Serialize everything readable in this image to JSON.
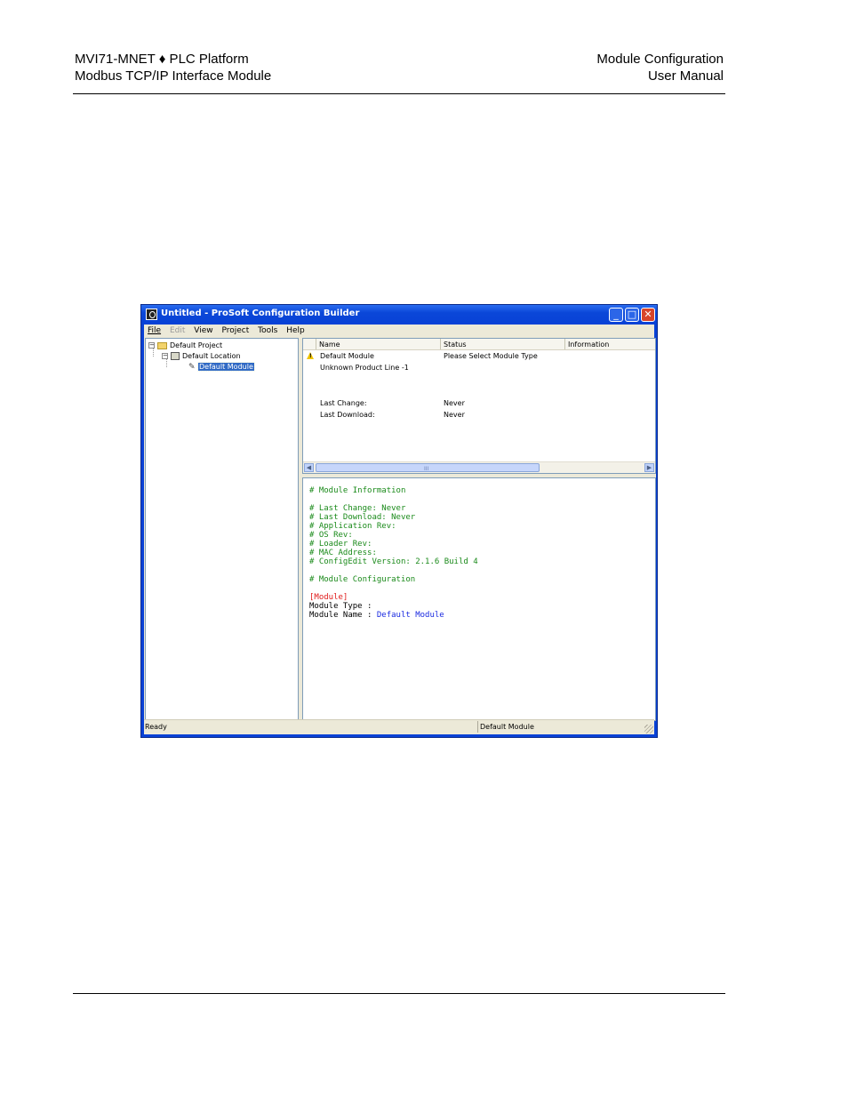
{
  "header": {
    "left_line1": "MVI71-MNET ♦ PLC Platform",
    "left_line2": "Modbus TCP/IP Interface Module",
    "right_line1": "Module Configuration",
    "right_line2": "User Manual"
  },
  "window": {
    "title": "Untitled - ProSoft Configuration Builder",
    "menu": {
      "file": "File",
      "edit": "Edit",
      "view": "View",
      "project": "Project",
      "tools": "Tools",
      "help": "Help"
    }
  },
  "tree": {
    "project": "Default Project",
    "location": "Default Location",
    "module": "Default Module",
    "expander_symbol": "−"
  },
  "list": {
    "columns": {
      "name": "Name",
      "status": "Status",
      "information": "Information"
    },
    "row_name": "Default Module",
    "row_status": "Please Select Module Type",
    "product_line": "Unknown Product Line -1",
    "last_change_label": "Last Change:",
    "last_change_value": "Never",
    "last_download_label": "Last Download:",
    "last_download_value": "Never",
    "scroll_grip": "III"
  },
  "config_text": {
    "l1": "# Module Information",
    "l2": "# Last Change: Never",
    "l3": "# Last Download: Never",
    "l4": "# Application Rev:",
    "l5": "# OS Rev:",
    "l6": "# Loader Rev:",
    "l7": "# MAC Address:",
    "l8": "# ConfigEdit Version: 2.1.6 Build 4",
    "l9": "# Module Configuration",
    "l10": "[Module]",
    "l11": "Module Type :",
    "l12_label": "Module Name : ",
    "l12_value": "Default Module"
  },
  "status": {
    "left": "Ready",
    "right": "Default Module"
  },
  "colors": {
    "titlebar": "#0841d6",
    "comment": "#1a8a1a",
    "section": "#e01a1a",
    "value": "#1a2ae0",
    "selection": "#316ac5"
  }
}
